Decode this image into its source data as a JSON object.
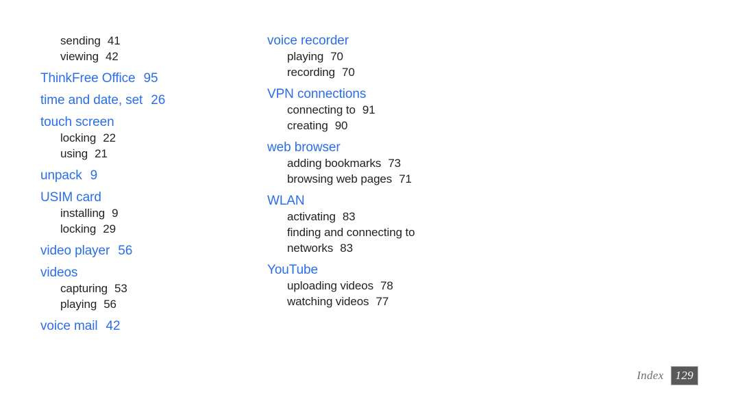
{
  "document": {
    "type": "index-page",
    "footer": {
      "label": "Index",
      "page_number": "129"
    },
    "colors": {
      "heading": "#2a6ee8",
      "subentry": "#231f20",
      "background": "#ffffff",
      "footer_label": "#6e6e6e",
      "footer_badge_bg": "#595959",
      "footer_badge_text": "#ffffff"
    }
  },
  "columns": [
    {
      "name": "left-column",
      "groups": [
        {
          "heading": null,
          "subentries": [
            {
              "label": "sending",
              "page": "41"
            },
            {
              "label": "viewing",
              "page": "42"
            }
          ]
        },
        {
          "heading": {
            "label": "ThinkFree Office",
            "page": "95"
          },
          "subentries": []
        },
        {
          "heading": {
            "label": "time and date, set",
            "page": "26"
          },
          "subentries": []
        },
        {
          "heading": {
            "label": "touch screen",
            "page": ""
          },
          "subentries": [
            {
              "label": "locking",
              "page": "22"
            },
            {
              "label": "using",
              "page": "21"
            }
          ]
        },
        {
          "heading": {
            "label": "unpack",
            "page": "9"
          },
          "subentries": []
        },
        {
          "heading": {
            "label": "USIM card",
            "page": ""
          },
          "subentries": [
            {
              "label": "installing",
              "page": "9"
            },
            {
              "label": "locking",
              "page": "29"
            }
          ]
        },
        {
          "heading": {
            "label": "video player",
            "page": "56"
          },
          "subentries": []
        },
        {
          "heading": {
            "label": "videos",
            "page": ""
          },
          "subentries": [
            {
              "label": "capturing",
              "page": "53"
            },
            {
              "label": "playing",
              "page": "56"
            }
          ]
        },
        {
          "heading": {
            "label": "voice mail",
            "page": "42"
          },
          "subentries": []
        }
      ]
    },
    {
      "name": "right-column",
      "groups": [
        {
          "heading": {
            "label": "voice recorder",
            "page": ""
          },
          "subentries": [
            {
              "label": "playing",
              "page": "70"
            },
            {
              "label": "recording",
              "page": "70"
            }
          ]
        },
        {
          "heading": {
            "label": "VPN connections",
            "page": ""
          },
          "subentries": [
            {
              "label": "connecting to",
              "page": "91"
            },
            {
              "label": "creating",
              "page": "90"
            }
          ]
        },
        {
          "heading": {
            "label": "web browser",
            "page": ""
          },
          "subentries": [
            {
              "label": "adding bookmarks",
              "page": "73"
            },
            {
              "label": "browsing web pages",
              "page": "71"
            }
          ]
        },
        {
          "heading": {
            "label": "WLAN",
            "page": ""
          },
          "subentries": [
            {
              "label": "activating",
              "page": "83"
            },
            {
              "label": "finding and connecting to networks",
              "page": "83",
              "wrapped": true
            }
          ]
        },
        {
          "heading": {
            "label": "YouTube",
            "page": ""
          },
          "subentries": [
            {
              "label": "uploading videos",
              "page": "78"
            },
            {
              "label": "watching videos",
              "page": "77"
            }
          ]
        }
      ]
    }
  ]
}
